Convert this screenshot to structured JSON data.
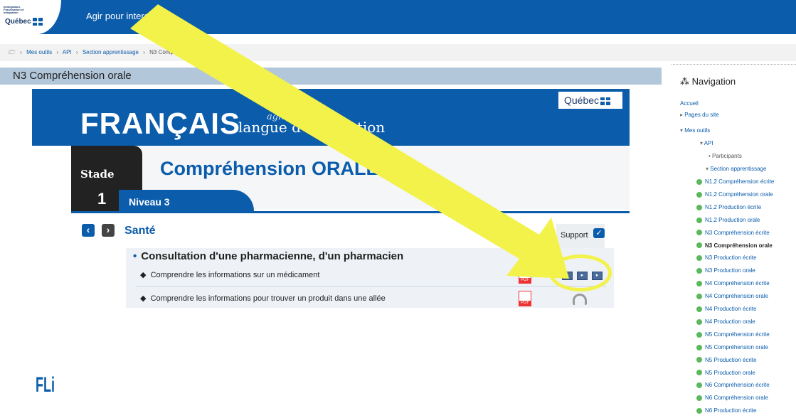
{
  "header": {
    "brand_small": "Immigration, Francisation et Intégration",
    "brand_name": "Québec",
    "site_title": "Agir pour interagir"
  },
  "breadcrumb": {
    "items": [
      "Mes outils",
      "API",
      "Section apprentissage",
      "N3 Compréhension orale"
    ]
  },
  "page": {
    "title": "N3 Compréhension orale"
  },
  "lesson": {
    "quebec_logo": "Québec",
    "francais": "FRANÇAIS",
    "script_text": "agir",
    "subtitle": "langue d'intégration",
    "stade_label": "Stade",
    "stade_number": "1",
    "skill_title": "Compréhension ORALE",
    "niveau": "Niveau 3",
    "theme": "Santé",
    "support_header": "Support",
    "section_title": "Consultation d'une pharmacienne, d'un pharmacien",
    "activities": [
      "Comprendre les informations sur un médicament",
      "Comprendre les informations pour trouver un produit dans une allée"
    ],
    "pdf_label": "PDF",
    "fli_logo": "FLi"
  },
  "navigation": {
    "title": "Navigation",
    "accueil": "Accueil",
    "pages_du_site": "Pages du site",
    "mes_outils": "Mes outils",
    "api": "API",
    "participants": "Participants",
    "section": "Section apprentissage",
    "items": [
      "N1,2 Compréhension écrite",
      "N1,2 Compréhension orale",
      "N1,2 Production écrite",
      "N1,2 Production orale",
      "N3 Compréhension écrite",
      "N3 Compréhension orale",
      "N3 Production écrite",
      "N3 Production orale",
      "N4 Compréhension écrite",
      "N4 Compréhension orale",
      "N4 Production écrite",
      "N4 Production orale",
      "N5 Compréhension écrite",
      "N5 Compréhension orale",
      "N5 Production écrite",
      "N5 Production orale",
      "N6 Compréhension écrite",
      "N6 Compréhension orale",
      "N6 Production écrite"
    ],
    "active_index": 5
  },
  "colors": {
    "brand_blue": "#0b5cab",
    "annotation_yellow": "#f2f24a",
    "resource_green": "#5cb85c"
  }
}
